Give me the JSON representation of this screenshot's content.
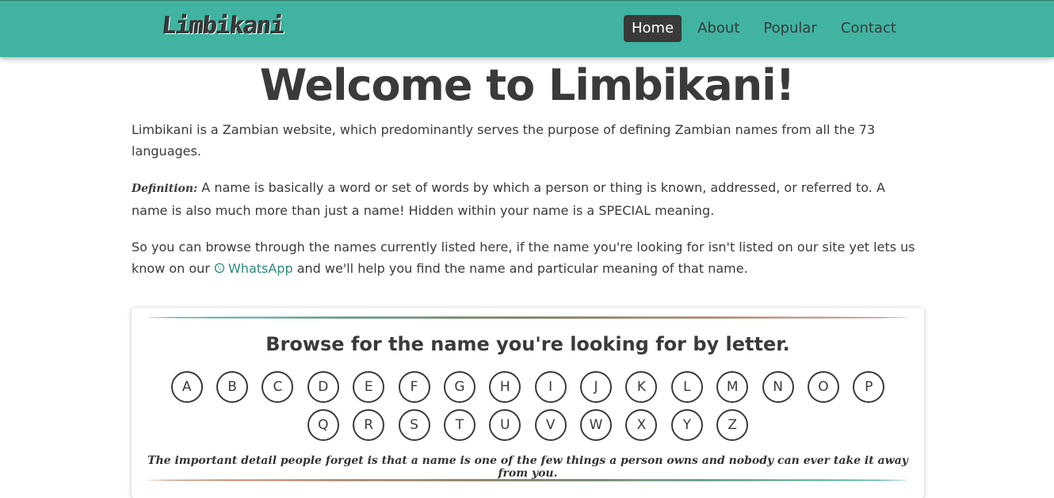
{
  "brand": {
    "logo_text": "Limbikani"
  },
  "nav": {
    "items": [
      {
        "label": "Home",
        "active": true
      },
      {
        "label": "About",
        "active": false
      },
      {
        "label": "Popular",
        "active": false
      },
      {
        "label": "Contact",
        "active": false
      }
    ]
  },
  "hero": {
    "title": "Welcome to Limbikani!"
  },
  "intro": {
    "p1": "Limbikani is a Zambian website, which predominantly serves the purpose of defining Zambian names from all the 73 languages.",
    "definition_label": "Definition:",
    "definition_text": " A name is basically a word or set of words by which a person or thing is known, addressed, or referred to. A name is also much more than just a name! Hidden within your name is a SPECIAL meaning.",
    "p3_before": "So you can browse through the names currently listed here, if the name you're looking for isn't listed on our site yet lets us know on our ",
    "whatsapp_label": "WhatsApp",
    "p3_after": " and we'll help you find the name and particular meaning of that name."
  },
  "browse": {
    "title": "Browse for the name you're looking for by letter.",
    "letters": [
      "A",
      "B",
      "C",
      "D",
      "E",
      "F",
      "G",
      "H",
      "I",
      "J",
      "K",
      "L",
      "M",
      "N",
      "O",
      "P",
      "Q",
      "R",
      "S",
      "T",
      "U",
      "V",
      "W",
      "X",
      "Y",
      "Z"
    ],
    "quote": "The important detail people forget is that a name is one of the few things a person owns and nobody can ever take it away from you."
  },
  "colors": {
    "navbar": "#40b3a1",
    "active_nav": "#3a3a3a",
    "link": "#2a8a7d",
    "gradient_end": "#d08a70"
  }
}
